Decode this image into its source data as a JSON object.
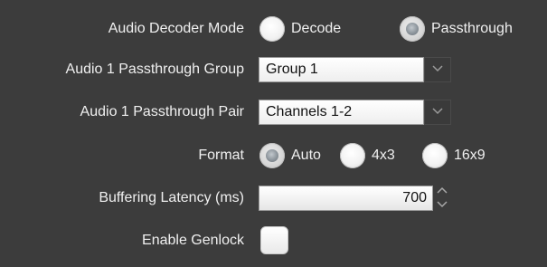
{
  "audio_decoder_mode": {
    "label": "Audio Decoder Mode",
    "options": [
      {
        "label": "Decode",
        "selected": false
      },
      {
        "label": "Passthrough",
        "selected": true
      }
    ]
  },
  "passthrough_group": {
    "label": "Audio 1 Passthrough Group",
    "value": "Group 1",
    "arrow_icon": "chevron-down-icon"
  },
  "passthrough_pair": {
    "label": "Audio 1 Passthrough Pair",
    "value": "Channels 1-2",
    "arrow_icon": "chevron-down-icon"
  },
  "format": {
    "label": "Format",
    "options": [
      {
        "label": "Auto",
        "selected": true
      },
      {
        "label": "4x3",
        "selected": false
      },
      {
        "label": "16x9",
        "selected": false
      }
    ]
  },
  "buffering_latency": {
    "label": "Buffering Latency (ms)",
    "value": "700"
  },
  "enable_genlock": {
    "label": "Enable Genlock",
    "checked": false
  },
  "colors": {
    "background": "#3c3c3c",
    "label_text": "#f0f0f0",
    "field_bg": "#ffffff"
  }
}
